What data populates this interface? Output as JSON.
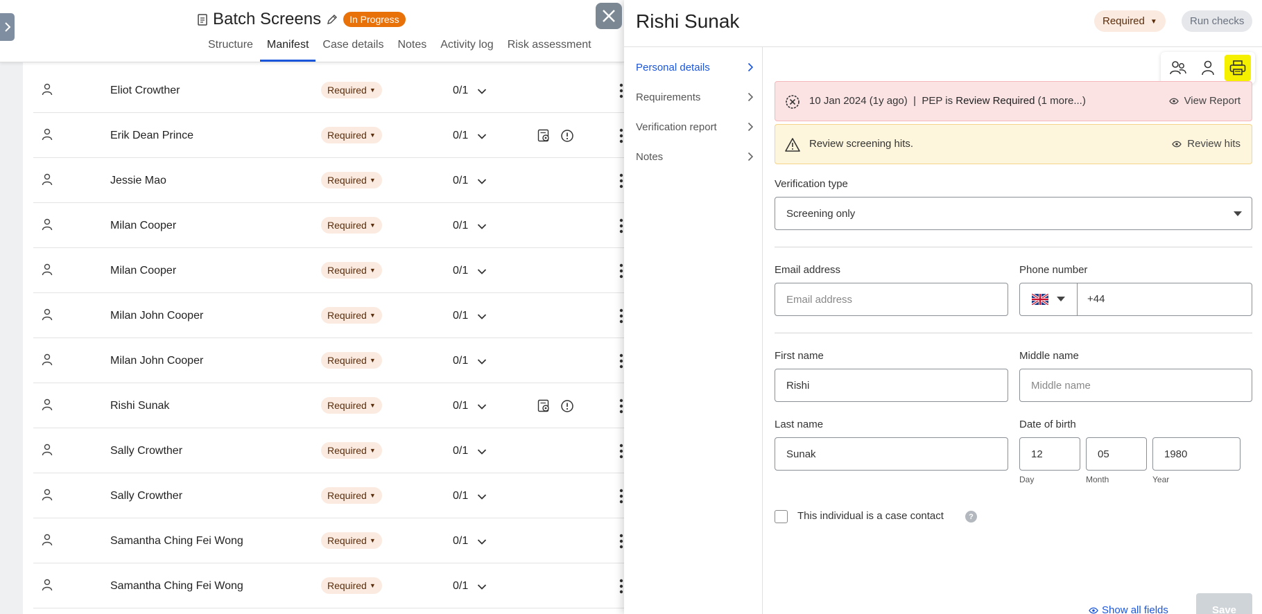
{
  "case": {
    "title": "Batch Screens",
    "status": "In Progress",
    "tabs": [
      "Structure",
      "Manifest",
      "Case details",
      "Notes",
      "Activity log",
      "Risk assessment"
    ],
    "active_tab": "Manifest"
  },
  "rows": [
    {
      "name": "Eliot Crowther",
      "status": "Required",
      "count": "0/1",
      "flags": false
    },
    {
      "name": "Erik Dean Prince",
      "status": "Required",
      "count": "0/1",
      "flags": true
    },
    {
      "name": "Jessie Mao",
      "status": "Required",
      "count": "0/1",
      "flags": false
    },
    {
      "name": "Milan Cooper",
      "status": "Required",
      "count": "0/1",
      "flags": false
    },
    {
      "name": "Milan Cooper",
      "status": "Required",
      "count": "0/1",
      "flags": false
    },
    {
      "name": "Milan John Cooper",
      "status": "Required",
      "count": "0/1",
      "flags": false
    },
    {
      "name": "Milan John Cooper",
      "status": "Required",
      "count": "0/1",
      "flags": false
    },
    {
      "name": "Rishi Sunak",
      "status": "Required",
      "count": "0/1",
      "flags": true
    },
    {
      "name": "Sally Crowther",
      "status": "Required",
      "count": "0/1",
      "flags": false
    },
    {
      "name": "Sally Crowther",
      "status": "Required",
      "count": "0/1",
      "flags": false
    },
    {
      "name": "Samantha Ching Fei Wong",
      "status": "Required",
      "count": "0/1",
      "flags": false
    },
    {
      "name": "Samantha Ching Fei Wong",
      "status": "Required",
      "count": "0/1",
      "flags": false
    }
  ],
  "drawer": {
    "title": "Rishi Sunak",
    "status": "Required",
    "run_checks": "Run checks",
    "nav": [
      {
        "label": "Personal details",
        "active": true
      },
      {
        "label": "Requirements",
        "active": false
      },
      {
        "label": "Verification report",
        "active": false
      },
      {
        "label": "Notes",
        "active": false
      }
    ],
    "alerts": {
      "pep_prefix": "10 Jan 2024 (1y ago)  |  PEP is ",
      "pep_strong": "Review Required",
      "pep_suffix": " (1 more...)",
      "view_report": "View Report",
      "hits": "Review screening hits.",
      "review_hits": "Review hits"
    },
    "form": {
      "verification_type_label": "Verification type",
      "verification_type_value": "Screening only",
      "email_label": "Email address",
      "email_placeholder": "Email address",
      "phone_label": "Phone number",
      "phone_code": "+44",
      "first_name_label": "First name",
      "first_name": "Rishi",
      "middle_name_label": "Middle name",
      "middle_name_placeholder": "Middle name",
      "last_name_label": "Last name",
      "last_name": "Sunak",
      "dob_label": "Date of birth",
      "dob_day": "12",
      "dob_month": "05",
      "dob_year": "1980",
      "day_label": "Day",
      "month_label": "Month",
      "year_label": "Year",
      "case_contact_label": "This individual is a case contact",
      "help": "?",
      "show_all": "Show all fields",
      "save": "Save"
    }
  },
  "colors": {
    "accent": "#1a56db",
    "status_orange": "#e8710a",
    "required_bg": "#fbeadf",
    "alert_red_bg": "#fbe3e4",
    "alert_yellow_bg": "#fef6dc",
    "highlight": "#f5f000"
  },
  "icons": [
    "document-icon",
    "pencil-icon",
    "person-icon",
    "chevron-down-icon",
    "screen-check-icon",
    "alert-circle-icon",
    "kebab-icon",
    "close-icon",
    "chevron-right-icon",
    "people-icon",
    "printer-icon",
    "x-circle-icon",
    "warning-icon",
    "eye-icon",
    "uk-flag-icon",
    "caret-down-icon",
    "help-icon"
  ]
}
